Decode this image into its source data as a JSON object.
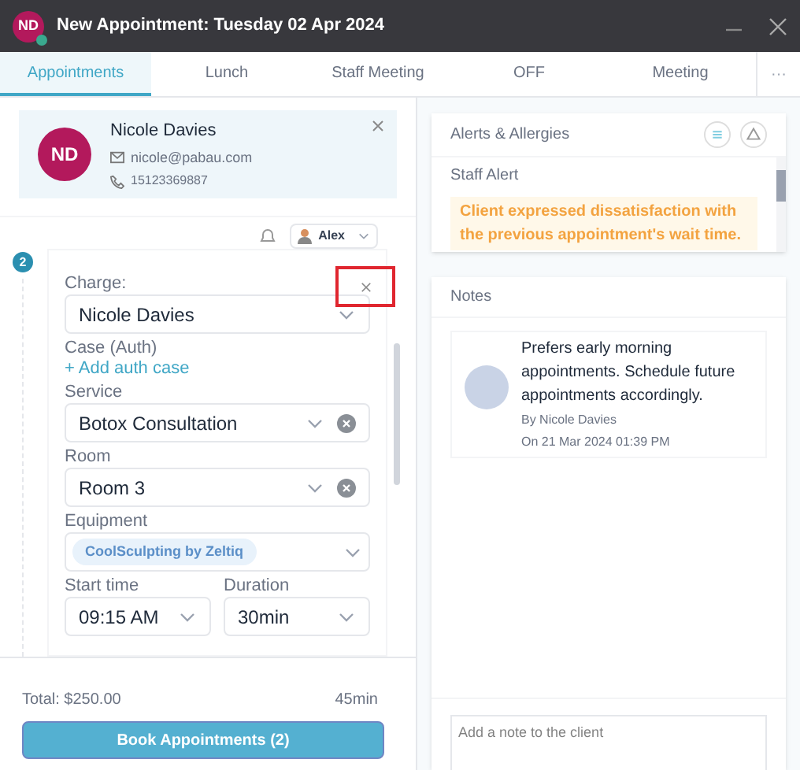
{
  "window": {
    "title": "New Appointment: Tuesday 02 Apr 2024",
    "avatar_initials": "ND"
  },
  "tabs": [
    {
      "label": "Appointments",
      "selected": true
    },
    {
      "label": "Lunch",
      "selected": false
    },
    {
      "label": "Staff Meeting",
      "selected": false
    },
    {
      "label": "OFF",
      "selected": false
    },
    {
      "label": "Meeting",
      "selected": false
    }
  ],
  "more_tabs": "···",
  "client": {
    "initials": "ND",
    "name": "Nicole Davies",
    "email": "nicole@pabau.com",
    "phone": "15123369887"
  },
  "staff_select": {
    "value": "Alex"
  },
  "appointment": {
    "step": "2",
    "fields": [
      {
        "kind": "select",
        "label": "Charge:",
        "value": "Nicole Davies",
        "clearable": false
      },
      {
        "kind": "link",
        "label": "Case (Auth)",
        "value": "+ Add auth case"
      },
      {
        "kind": "select",
        "label": "Service",
        "value": "Botox Consultation",
        "clearable": true
      },
      {
        "kind": "select",
        "label": "Room",
        "value": "Room 3",
        "clearable": true
      },
      {
        "kind": "tags",
        "label": "Equipment",
        "tags": [
          "CoolSculpting by Zeltiq"
        ]
      }
    ],
    "start_time": {
      "label": "Start time",
      "value": "09:15 AM"
    },
    "duration": {
      "label": "Duration",
      "value": "30min"
    }
  },
  "footer": {
    "total": "Total: $250.00",
    "duration": "45min",
    "book_button": "Book Appointments (2)"
  },
  "alerts": {
    "title": "Alerts & Allergies",
    "section": "Staff Alert",
    "message": "Client expressed dissatisfaction with the previous appointment's wait time."
  },
  "notes": {
    "title": "Notes",
    "items": [
      {
        "text": "Prefers early morning appointments. Schedule future appointments accordingly.",
        "author": "By Nicole Davies",
        "date": "On 21 Mar 2024 01:39 PM"
      }
    ],
    "input": {
      "placeholder": "Add a note to the client"
    }
  }
}
